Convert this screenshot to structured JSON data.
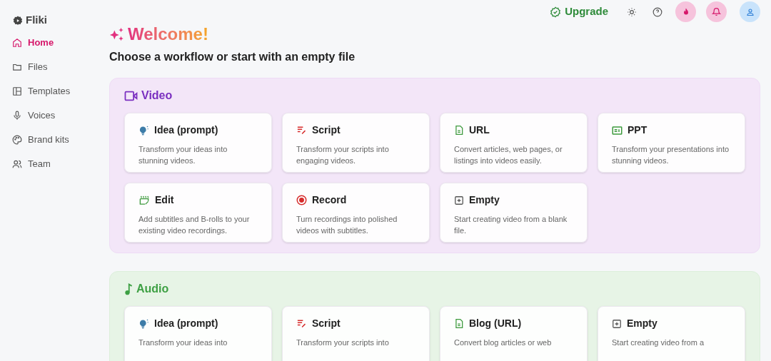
{
  "brand": {
    "name": "Fliki"
  },
  "sidebar": {
    "items": [
      {
        "label": "Home",
        "selected": true
      },
      {
        "label": "Files",
        "selected": false
      },
      {
        "label": "Templates",
        "selected": false
      },
      {
        "label": "Voices",
        "selected": false
      },
      {
        "label": "Brand kits",
        "selected": false
      },
      {
        "label": "Team",
        "selected": false
      }
    ]
  },
  "topbar": {
    "upgrade": "Upgrade"
  },
  "welcome": "Welcome!",
  "subtitle": "Choose a workflow or start with an empty file",
  "sections": [
    {
      "title": "Video",
      "kind": "video",
      "cards": [
        {
          "kind": "idea",
          "title": "Idea (prompt)",
          "description": "Transform your ideas into stunning videos."
        },
        {
          "kind": "script",
          "title": "Script",
          "description": "Transform your scripts into engaging videos."
        },
        {
          "kind": "url",
          "title": "URL",
          "description": "Convert articles, web pages, or listings into videos easily."
        },
        {
          "kind": "ppt",
          "title": "PPT",
          "description": "Transform your presentations into stunning videos."
        },
        {
          "kind": "edit",
          "title": "Edit",
          "description": "Add subtitles and B-rolls to your existing video recordings."
        },
        {
          "kind": "record",
          "title": "Record",
          "description": "Turn recordings into polished videos with subtitles."
        },
        {
          "kind": "empty",
          "title": "Empty",
          "description": "Start creating video from a blank file."
        }
      ]
    },
    {
      "title": "Audio",
      "kind": "audio",
      "cards": [
        {
          "kind": "idea",
          "title": "Idea (prompt)",
          "description": "Transform your ideas into"
        },
        {
          "kind": "script",
          "title": "Script",
          "description": "Transform your scripts into"
        },
        {
          "kind": "url",
          "title": "Blog (URL)",
          "description": "Convert blog articles or web"
        },
        {
          "kind": "empty",
          "title": "Empty",
          "description": "Start creating video from a"
        }
      ]
    }
  ]
}
